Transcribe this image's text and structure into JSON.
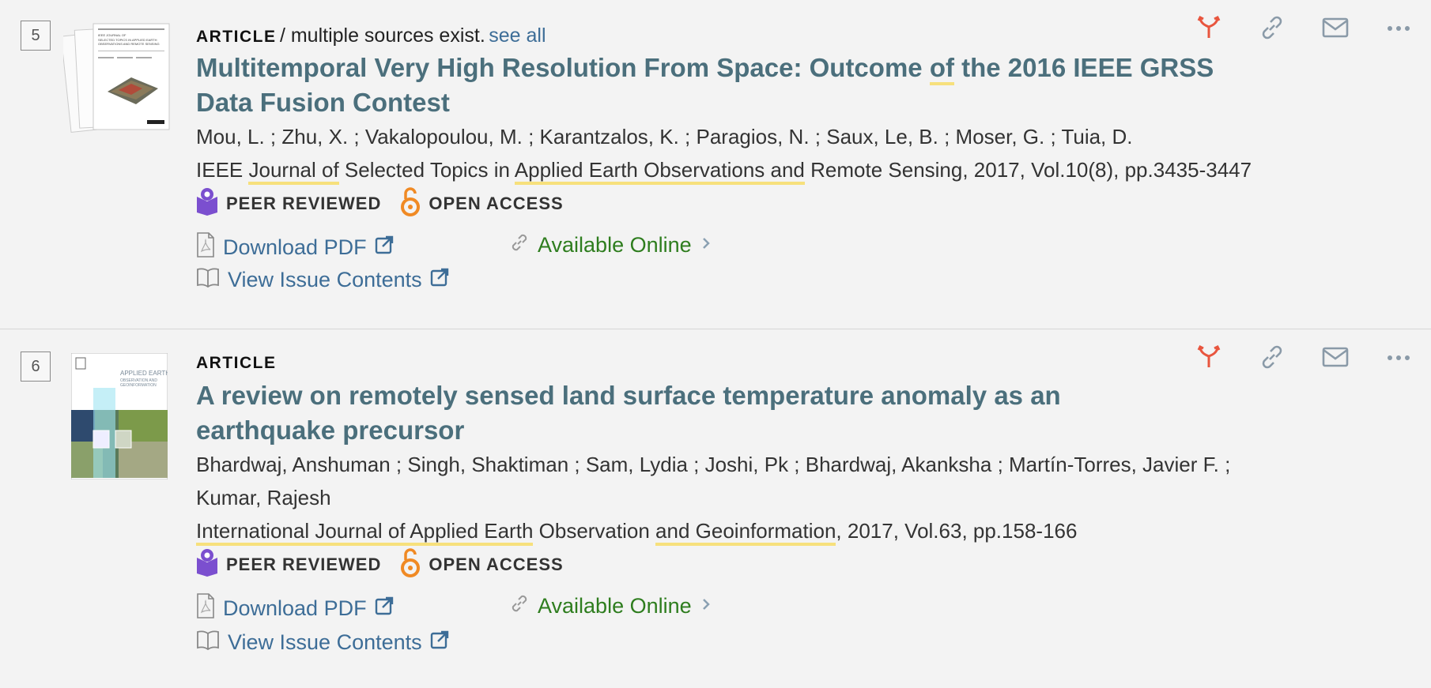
{
  "results": [
    {
      "number": "5",
      "type": "ARTICLE",
      "source_note": "/ multiple sources exist.",
      "see_all": "see all",
      "title_line1_a": "Multitemporal Very High Resolution From Space: Outcome ",
      "title_line1_hl": "of",
      "title_line1_b": " the 2016 IEEE GRSS",
      "title_line2": "Data Fusion Contest",
      "authors": "Mou, L. ; Zhu, X. ; Vakalopoulou, M. ; Karantzalos, K. ; Paragios, N. ; Saux, Le, B. ; Moser, G. ; Tuia, D.",
      "source_parts": [
        "IEEE ",
        "Journal of",
        " Selected Topics in ",
        "Applied Earth Observations and",
        " Remote Sensing, 2017, Vol.10(8), pp.3435-3447"
      ],
      "peer_reviewed": "PEER REVIEWED",
      "open_access": "OPEN ACCESS",
      "download_pdf": "Download PDF",
      "available_online": "Available Online",
      "view_issue": "View Issue Contents"
    },
    {
      "number": "6",
      "type": "ARTICLE",
      "title_line1": "A review on remotely sensed land surface temperature anomaly as an",
      "title_line2": "earthquake precursor",
      "authors_line1": "Bhardwaj, Anshuman ; Singh, Shaktiman ; Sam, Lydia ; Joshi, Pk ; Bhardwaj, Akanksha ; Martín-Torres, Javier F. ;",
      "authors_line2": "Kumar, Rajesh",
      "source_parts": [
        "International Journal of Applied Earth",
        " Observation ",
        "and Geoinformation",
        ", 2017, Vol.63, pp.158-166"
      ],
      "peer_reviewed": "PEER REVIEWED",
      "open_access": "OPEN ACCESS",
      "download_pdf": "Download PDF",
      "available_online": "Available Online",
      "view_issue": "View Issue Contents"
    }
  ],
  "colors": {
    "title": "#4b6f7c",
    "link": "#3d6d97",
    "available": "#2e7d1e",
    "highlight": "#f7e07c",
    "action_icon": "#e8553e",
    "peer_icon": "#7b4fcf",
    "oa_icon": "#f08a24"
  },
  "cover_text_1": [
    "IEEE JOURNAL OF",
    "SELECTED TOPICS IN APPLIED EARTH",
    "OBSERVATIONS AND REMOTE SENSING"
  ],
  "cover_text_2": [
    "APPLIED EARTH",
    "OBSERVATION AND",
    "GEOINFORMATION"
  ],
  "icons": [
    "cite-icon",
    "permalink-icon",
    "email-icon",
    "more-icon",
    "peer-reviewed-icon",
    "open-access-icon",
    "pdf-icon",
    "external-link-icon",
    "link-icon",
    "chevron-right-icon",
    "book-icon"
  ]
}
